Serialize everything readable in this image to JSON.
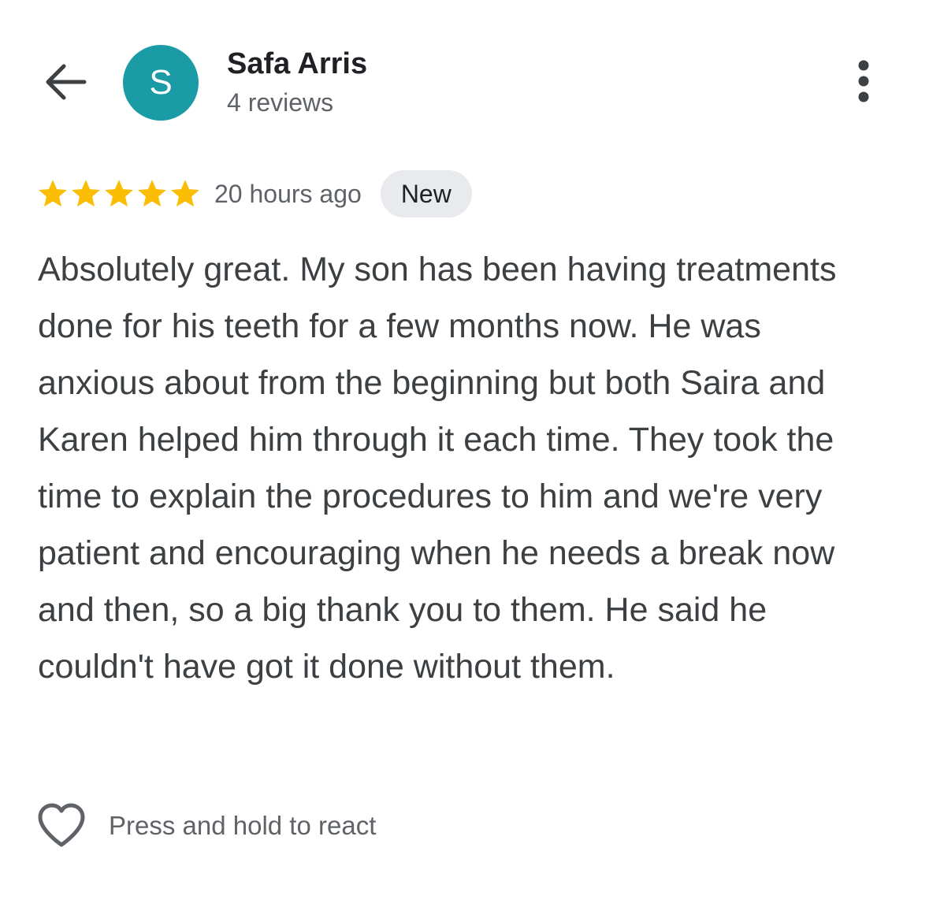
{
  "header": {
    "back_icon": "arrow-back-icon",
    "avatar_letter": "S",
    "avatar_color": "#1a9ba6",
    "reviewer_name": "Safa Arris",
    "reviewer_subtitle": "4 reviews",
    "more_icon": "more-vert-icon"
  },
  "review": {
    "rating": 5,
    "rating_max": 5,
    "star_color": "#fbbc04",
    "time_ago": "20 hours ago",
    "badge": "New",
    "text": "Absolutely great. My son has been having treatments done for his teeth for a few months now. He was anxious about from the beginning but both Saira and Karen helped him through it each time. They took the time to explain the procedures to him and we're very patient and encouraging when he needs a break now and then, so a big thank you to them. He said he couldn't have got it done without them."
  },
  "reactions": {
    "icon": "heart-outline-icon",
    "label": "Press and hold to react"
  }
}
